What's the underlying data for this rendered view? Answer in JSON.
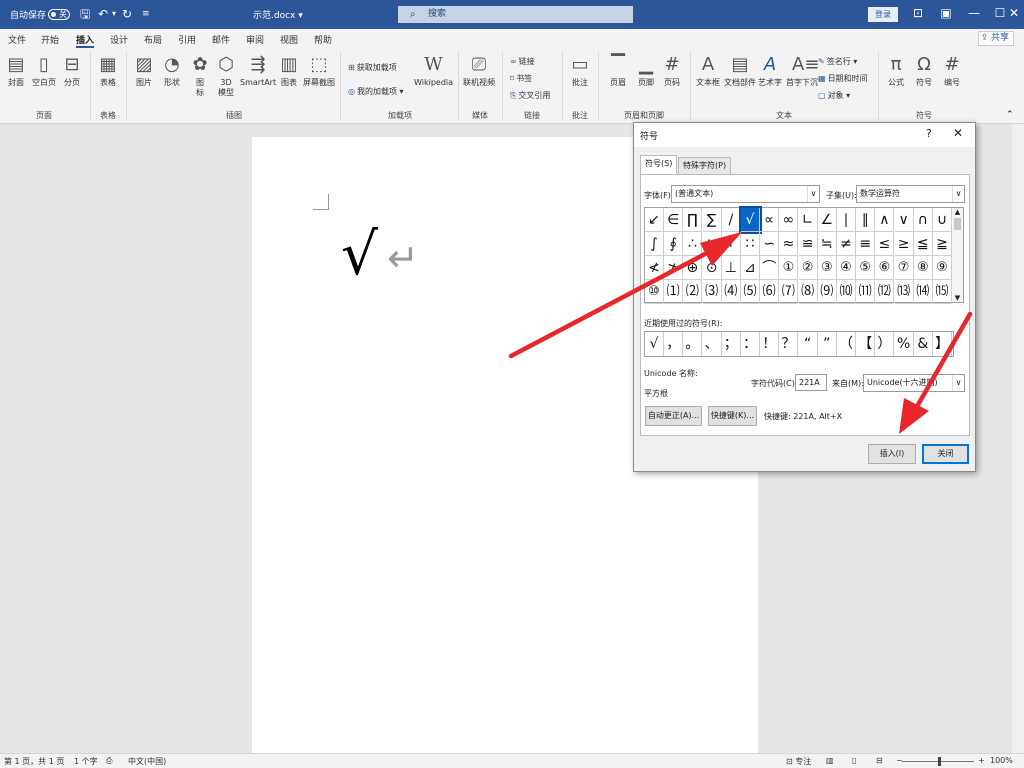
{
  "titlebar": {
    "autosave_label": "自动保存",
    "autosave_state": "关",
    "doc_title": "示范.docx",
    "doc_title_chevron": "▾",
    "search_placeholder": "搜索",
    "login_label": "登录"
  },
  "menu": {
    "tabs": [
      "文件",
      "开始",
      "插入",
      "设计",
      "布局",
      "引用",
      "邮件",
      "审阅",
      "视图",
      "帮助"
    ],
    "active_tab": "插入",
    "share_label": "共享"
  },
  "ribbon": {
    "pages": {
      "cover": "封面",
      "blank": "空白页",
      "break": "分页",
      "group": "页面"
    },
    "tables": {
      "table": "表格",
      "group": "表格"
    },
    "illustrations": {
      "picture": "图片",
      "shapes": "形状",
      "icons_a": "图",
      "icons_b": "标",
      "model_a": "3D",
      "model_b": "模型",
      "smartart": "SmartArt",
      "chart": "图表",
      "screenshot": "屏幕截图",
      "group": "插图"
    },
    "addins": {
      "get": "获取加载项",
      "mine": "我的加载项",
      "wiki_glyph": "W",
      "wikipedia": "Wikipedia",
      "group": "加载项"
    },
    "media": {
      "video": "联机视频",
      "group": "媒体"
    },
    "links": {
      "link": "链接",
      "bookmark": "书签",
      "crossref": "交叉引用",
      "group": "链接"
    },
    "comments": {
      "comment": "批注",
      "group": "批注"
    },
    "headerfooter": {
      "header": "页眉",
      "footer": "页脚",
      "pagenum": "页码",
      "group": "页眉和页脚"
    },
    "text": {
      "textbox": "文本框",
      "quickparts": "文档部件",
      "wordart": "艺术字",
      "dropcap": "首字下沉",
      "signature": "签名行",
      "datetime": "日期和时间",
      "object": "对象",
      "group": "文本"
    },
    "symbols": {
      "equation": "公式",
      "symbol": "符号",
      "number": "编号",
      "group": "符号"
    }
  },
  "document": {
    "inserted_symbol": "√",
    "paragraph_mark": "↵"
  },
  "dialog": {
    "title": "符号",
    "help": "?",
    "close": "✕",
    "tabs": [
      "符号(S)",
      "特殊字符(P)"
    ],
    "font_label": "字体(F):",
    "font_value": "(普通文本)",
    "subset_label": "子集(U):",
    "subset_value": "数学运算符",
    "symbols": [
      "↙",
      "∈",
      "∏",
      "∑",
      "∕",
      "√",
      "∝",
      "∞",
      "∟",
      "∠",
      "∣",
      "∥",
      "∧",
      "∨",
      "∩",
      "∪",
      "∫",
      "∮",
      "∴",
      "∵",
      "∶",
      "∷",
      "∽",
      "≈",
      "≌",
      "≒",
      "≠",
      "≡",
      "≤",
      "≥",
      "≦",
      "≧",
      "≮",
      "≯",
      "⊕",
      "⊙",
      "⊥",
      "⊿",
      "⌒",
      "①",
      "②",
      "③",
      "④",
      "⑤",
      "⑥",
      "⑦",
      "⑧",
      "⑨",
      "⑩",
      "⑴",
      "⑵",
      "⑶",
      "⑷",
      "⑸",
      "⑹",
      "⑺",
      "⑻",
      "⑼",
      "⑽",
      "⑾",
      "⑿",
      "⒀",
      "⒁",
      "⒂"
    ],
    "selected_symbol": "√",
    "scroll_up": "▲",
    "scroll_down": "▼",
    "recent_label": "近期使用过的符号(R):",
    "recent": [
      "√",
      "，",
      "。",
      "、",
      "；",
      "：",
      "！",
      "？",
      "“",
      "”",
      "（",
      "【",
      "）",
      "%",
      "&",
      "】"
    ],
    "unicode_name_label": "Unicode 名称:",
    "unicode_name": "平方根",
    "charcode_label": "字符代码(C):",
    "charcode_value": "221A",
    "from_label": "来自(M):",
    "from_value": "Unicode(十六进制)",
    "autocorrect_btn": "自动更正(A)...",
    "shortcut_btn": "快捷键(K)...",
    "shortcut_text": "快捷键: 221A, Alt+X",
    "insert_btn": "插入(I)",
    "close_btn": "关闭"
  },
  "statusbar": {
    "pages": "第 1 页，共 1 页",
    "words": "1 个字",
    "lang": "中文(中国)",
    "focus": "专注",
    "zoom": "100%",
    "zoom_minus": "−",
    "zoom_plus": "+"
  },
  "colors": {
    "titlebar": "#2b579a",
    "arrow": "#e8262b",
    "selected": "#0a66c8"
  }
}
